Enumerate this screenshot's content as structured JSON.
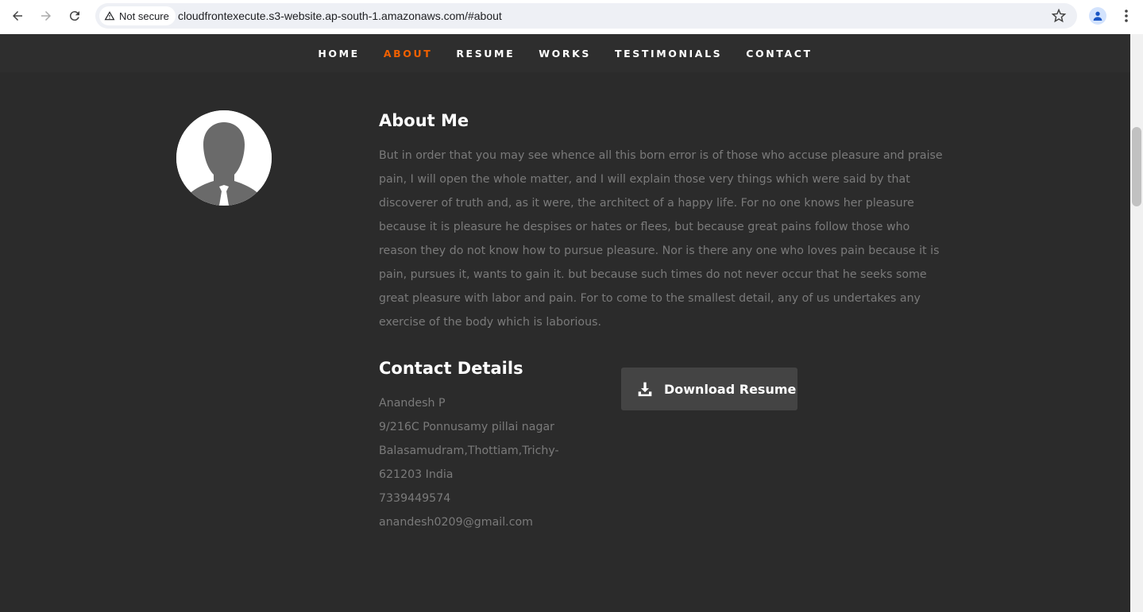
{
  "browser": {
    "security_label": "Not secure",
    "url": "cloudfrontexecute.s3-website.ap-south-1.amazonaws.com/#about"
  },
  "site_nav": {
    "items": [
      {
        "label": "HOME",
        "active": false
      },
      {
        "label": "ABOUT",
        "active": true
      },
      {
        "label": "RESUME",
        "active": false
      },
      {
        "label": "WORKS",
        "active": false
      },
      {
        "label": "TESTIMONIALS",
        "active": false
      },
      {
        "label": "CONTACT",
        "active": false
      }
    ],
    "active_color": "#f06000"
  },
  "about": {
    "title": "About Me",
    "lines": [
      "But in order that you may see whence all this born error is of those who accuse pleasure and praise",
      "pain, I will open the whole matter, and I will explain those very things which were said by that",
      "discoverer of truth and, as it were, the architect of a happy life. For no one knows her pleasure",
      "because it is pleasure he despises or hates or flees, but because great pains follow those who",
      "reason they do not know how to pursue pleasure. Nor is there any one who loves pain because it is",
      "pain, pursues it, wants to gain it. but because such times do not never occur that he seeks some",
      "great pleasure with labor and pain. For to come to the smallest detail, any of us undertakes any",
      "exercise of the body which is laborious."
    ]
  },
  "contact": {
    "title": "Contact Details",
    "name": "Anandesh P",
    "address1": "9/216C Ponnusamy pillai nagar",
    "address2": "Balasamudram,Thottiam,Trichy-",
    "address3": "621203 India",
    "phone": "7339449574",
    "email": "anandesh0209@gmail.com"
  },
  "download": {
    "label": "Download Resume",
    "icon": "download-icon"
  }
}
